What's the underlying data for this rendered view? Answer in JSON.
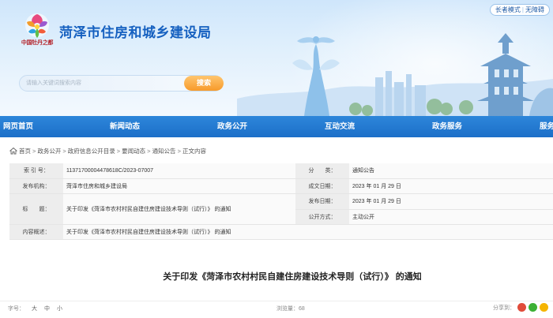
{
  "header": {
    "logo_caption": "中国牡丹之都",
    "site_title": "菏泽市住房和城乡建设局",
    "tools": {
      "elder_mode": "长者模式",
      "accessibility": "无障碍"
    },
    "search": {
      "placeholder": "请输入关键词搜索内容",
      "button_label": "搜索"
    }
  },
  "nav": {
    "items": [
      {
        "label": "网页首页"
      },
      {
        "label": "新闻动态"
      },
      {
        "label": "政务公开"
      },
      {
        "label": "互动交流"
      },
      {
        "label": "政务服务"
      },
      {
        "label": "服务"
      }
    ]
  },
  "breadcrumb": {
    "items": [
      "首页",
      "政务公开",
      "政府信息公开目录",
      "要闻动态",
      "通知公告",
      "正文内容"
    ],
    "separator": ">"
  },
  "info": {
    "index_label": "索 引 号：",
    "index_value": "11371700004478618C/2023-07007",
    "category_label": "分　　类：",
    "category_value": "通知公告",
    "publisher_label": "发布机构：",
    "publisher_value": "菏泽市住房和城乡建设局",
    "created_label": "成文日期：",
    "created_value": "2023 年 01 月 29 日",
    "title_label": "标　　题：",
    "title_value": "关于印发《菏泽市农村村民自建住房建设技术导则（试行）》 的通知",
    "published_label": "发布日期：",
    "published_value": "2023 年 01 月 29 日",
    "method_label": "公开方式：",
    "method_value": "主动公开",
    "summary_label": "内容概述：",
    "summary_value": "关于印发《菏泽市农村村民自建住房建设技术导则（试行）》 的通知"
  },
  "article": {
    "title": "关于印发《菏泽市农村村民自建住房建设技术导则（试行）》 的通知"
  },
  "footer": {
    "font_size_label": "字号：",
    "font_large": "大",
    "font_medium": "中",
    "font_small": "小",
    "views_label": "浏览量：",
    "views_count": "68",
    "share_label": "分享到："
  },
  "colors": {
    "brand_blue": "#1c6fc8",
    "title_blue": "#1560c0",
    "search_orange": "#f79a2a"
  }
}
